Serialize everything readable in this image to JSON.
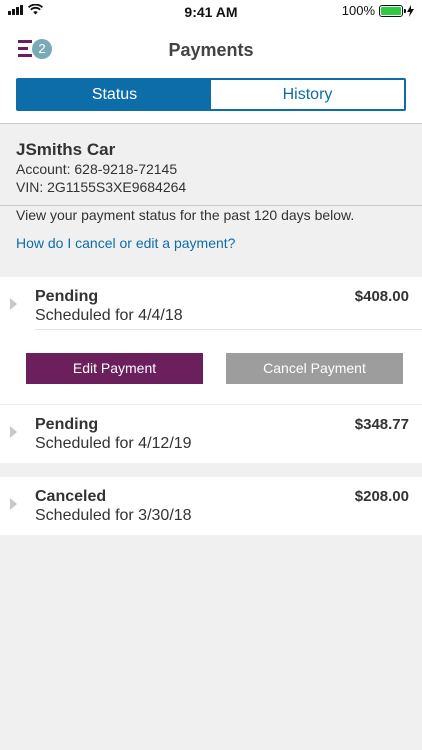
{
  "status_bar": {
    "time": "9:41 AM",
    "battery": "100%"
  },
  "header": {
    "logo_badge": "2",
    "title": "Payments"
  },
  "tabs": [
    {
      "label": "Status"
    },
    {
      "label": "History"
    }
  ],
  "account": {
    "name": "JSmiths Car",
    "account_line": "Account: 628-9218-72145",
    "vin_line": "VIN: 2G1155S3XE9684264"
  },
  "info_text": "View your payment status for the past 120 days below.",
  "help_link": "How do I cancel or edit a payment?",
  "payments": [
    {
      "status": "Pending",
      "scheduled": "Scheduled for 4/4/18",
      "amount": "$408.00"
    },
    {
      "status": "Pending",
      "scheduled": "Scheduled for 4/12/19",
      "amount": "$348.77"
    },
    {
      "status": "Canceled",
      "scheduled": "Scheduled for 3/30/18",
      "amount": "$208.00"
    }
  ],
  "actions": {
    "edit_label": "Edit Payment",
    "cancel_label": "Cancel Payment"
  },
  "colors": {
    "accent_blue": "#0d6da8",
    "brand_purple": "#6b1f5c",
    "cancel_gray": "#9d9d9d"
  }
}
